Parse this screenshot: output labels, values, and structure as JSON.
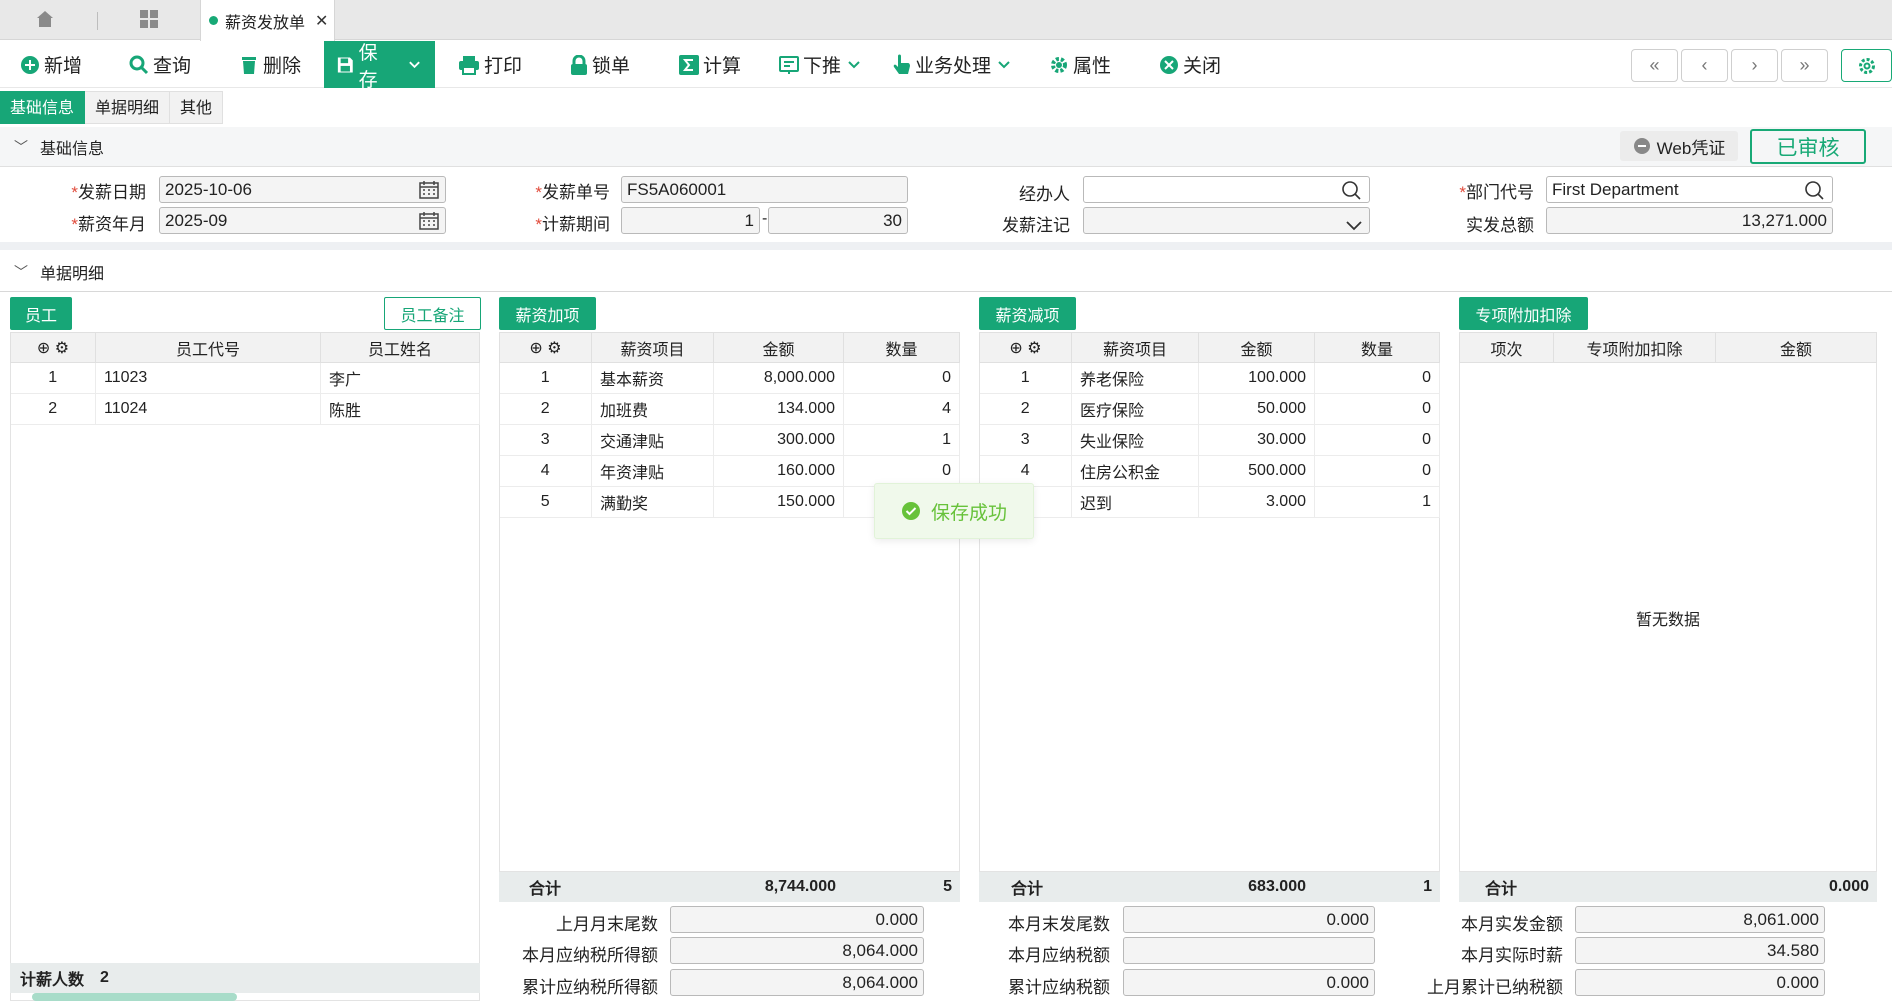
{
  "tabstrip": {
    "doc_tab": "薪资发放单"
  },
  "toolbar": {
    "add": "新增",
    "query": "查询",
    "delete": "删除",
    "save": "保存",
    "print": "打印",
    "lock": "锁单",
    "calc": "计算",
    "push": "下推",
    "business": "业务处理",
    "props": "属性",
    "close": "关闭"
  },
  "section_tabs": [
    "基础信息",
    "单据明细",
    "其他"
  ],
  "basic": {
    "title": "基础信息",
    "web_voucher": "Web凭证",
    "status": "已审核",
    "pay_date_label": "发薪日期",
    "pay_date": "2025-10-06",
    "salary_month_label": "薪资年月",
    "salary_month": "2025-09",
    "doc_no_label": "发薪单号",
    "doc_no": "FS5A060001",
    "period_label": "计薪期间",
    "period_from": "1",
    "period_sep": "-",
    "period_to": "30",
    "handler_label": "经办人",
    "handler": "",
    "note_label": "发薪注记",
    "note": "",
    "dept_label": "部门代号",
    "dept": "First Department",
    "total_label": "实发总额",
    "total": "13,271.000"
  },
  "detail": {
    "title": "单据明细",
    "employee": {
      "btn": "员工",
      "note_btn": "员工备注",
      "headers": [
        "员工代号",
        "员工姓名"
      ],
      "rows": [
        [
          "1",
          "11023",
          "李广"
        ],
        [
          "2",
          "11024",
          "陈胜"
        ]
      ],
      "count_label": "计薪人数",
      "count": "2"
    },
    "add_items": {
      "btn": "薪资加项",
      "headers": [
        "薪资项目",
        "金额",
        "数量"
      ],
      "rows": [
        [
          "1",
          "基本薪资",
          "8,000.000",
          "0"
        ],
        [
          "2",
          "加班费",
          "134.000",
          "4"
        ],
        [
          "3",
          "交通津贴",
          "300.000",
          "1"
        ],
        [
          "4",
          "年资津贴",
          "160.000",
          "0"
        ],
        [
          "5",
          "满勤奖",
          "150.000",
          ""
        ]
      ],
      "sum_label": "合计",
      "sum_amount": "8,744.000",
      "sum_qty": "5",
      "last_tail_label": "上月月末尾数",
      "last_tail": "0.000",
      "taxable_label": "本月应纳税所得额",
      "taxable": "8,064.000",
      "cum_taxable_label": "累计应纳税所得额",
      "cum_taxable": "8,064.000"
    },
    "deduct_items": {
      "btn": "薪资减项",
      "headers": [
        "薪资项目",
        "金额",
        "数量"
      ],
      "rows": [
        [
          "1",
          "养老保险",
          "100.000",
          "0"
        ],
        [
          "2",
          "医疗保险",
          "50.000",
          "0"
        ],
        [
          "3",
          "失业保险",
          "30.000",
          "0"
        ],
        [
          "4",
          "住房公积金",
          "500.000",
          "0"
        ],
        [
          "",
          "迟到",
          "3.000",
          "1"
        ]
      ],
      "sum_label": "合计",
      "sum_amount": "683.000",
      "sum_qty": "1",
      "tail_label": "本月末发尾数",
      "tail": "0.000",
      "tax_label": "本月应纳税额",
      "tax": "",
      "cum_tax_label": "累计应纳税额",
      "cum_tax": "0.000"
    },
    "special": {
      "btn": "专项附加扣除",
      "headers": [
        "项次",
        "专项附加扣除",
        "金额"
      ],
      "empty": "暂无数据",
      "sum_label": "合计",
      "sum_amount": "0.000",
      "actual_label": "本月实发金额",
      "actual": "8,061.000",
      "hourly_label": "本月实际时薪",
      "hourly": "34.580",
      "last_cum_tax_label": "上月累计已纳税额",
      "last_cum_tax": "0.000"
    }
  },
  "toast": "保存成功"
}
